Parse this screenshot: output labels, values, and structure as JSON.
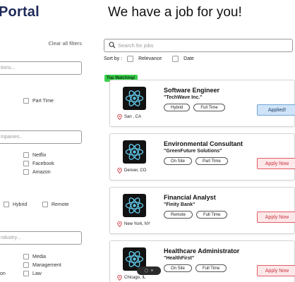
{
  "header": {
    "brand": "Portal",
    "headline": "We have a job for you!"
  },
  "filters": {
    "clear_all": "Clear all filters",
    "location_placeholder": "tions...",
    "companies_placeholder": "mpanies..",
    "industry_placeholder": "ndustry...",
    "job_type": {
      "part_time": "Part Time"
    },
    "companies": [
      "Netflix",
      "Facebook",
      "Amazon"
    ],
    "work_mode": {
      "hybrid": "Hybrid",
      "remote": "Remote"
    },
    "industries": [
      "Media",
      "Management",
      "Law"
    ],
    "industry_left_partial": "on"
  },
  "search": {
    "placeholder": "Search for jobs"
  },
  "sort": {
    "label": "Sort by :",
    "relevance": "Relevance",
    "date": "Date"
  },
  "top_badge": "Top Matching!",
  "jobs": [
    {
      "title": "Software Engineer",
      "company": "\"TechWave Inc.\"",
      "location": "San , CA",
      "mode": "Hybrid",
      "type": "Full Time",
      "action": "Applied!"
    },
    {
      "title": "Environmental Consultant",
      "company": "\"GreenFuture Solutions\"",
      "location": "Denver, CO",
      "mode": "On Site",
      "type": "Part Time",
      "action": "Apply Now"
    },
    {
      "title": "Financial Analyst",
      "company": "\"Finity Bank\"",
      "location": "New York, NY",
      "mode": "Remote",
      "type": "Full Time",
      "action": "Apply Now"
    },
    {
      "title": "Healthcare Administrator",
      "company": "\"HealthFirst\"",
      "location": "Chicago, IL",
      "mode": "On Site",
      "type": "Full Time",
      "action": "Apply Now"
    }
  ],
  "colors": {
    "brand": "#1f2a5a",
    "applied_bg": "#cfe4f8",
    "apply_border": "#e35a63",
    "top_badge": "#38d14a"
  }
}
